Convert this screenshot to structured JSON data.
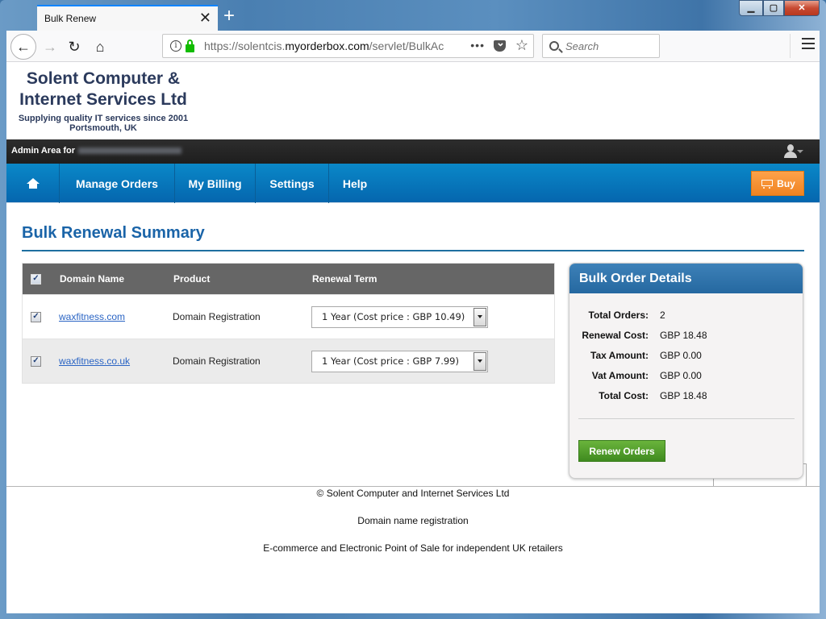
{
  "browser": {
    "tab_title": "Bulk Renew",
    "tab_close_glyph": "✕",
    "new_tab_glyph": "+",
    "url_prefix": "https://solentcis.",
    "url_domain": "myorderbox.com",
    "url_suffix": "/servlet/BulkAc",
    "search_placeholder": "Search",
    "window_controls": {
      "minimize": "▁",
      "maximize": "▢",
      "close": "✕"
    }
  },
  "site": {
    "logo_line1": "Solent Computer &",
    "logo_line2": "Internet Services Ltd",
    "tagline": "Supplying quality IT services since 2001",
    "location": "Portsmouth, UK",
    "admin_label": "Admin Area for"
  },
  "nav": {
    "items": [
      {
        "label": "Manage Orders"
      },
      {
        "label": "My Billing"
      },
      {
        "label": "Settings"
      },
      {
        "label": "Help"
      }
    ],
    "buy_label": "Buy"
  },
  "main": {
    "title": "Bulk Renewal Summary",
    "table": {
      "headers": {
        "domain": "Domain Name",
        "product": "Product",
        "term": "Renewal Term"
      },
      "rows": [
        {
          "checked": true,
          "domain": "waxfitness.com",
          "product": "Domain Registration",
          "term": "1 Year (Cost price : GBP 10.49)"
        },
        {
          "checked": true,
          "domain": "waxfitness.co.uk",
          "product": "Domain Registration",
          "term": "1 Year (Cost price : GBP 7.99)"
        }
      ]
    }
  },
  "order_details": {
    "title": "Bulk Order Details",
    "rows": [
      {
        "label": "Total Orders:",
        "value": "2"
      },
      {
        "label": "Renewal Cost:",
        "value": "GBP 18.48"
      },
      {
        "label": "Tax Amount:",
        "value": "GBP 0.00"
      },
      {
        "label": "Vat Amount:",
        "value": "GBP 0.00"
      },
      {
        "label": "Total Cost:",
        "value": "GBP 18.48"
      }
    ],
    "renew_button": "Renew Orders"
  },
  "footer": {
    "copyright": "© Solent Computer and Internet Services Ltd",
    "line2": "Domain name registration",
    "line3": "E-commerce and Electronic Point of Sale for independent UK retailers"
  },
  "colors": {
    "nav_blue": "#0a7bc0",
    "title_blue": "#1a64a8",
    "buy_orange": "#f68e2c",
    "renew_green": "#4f9b2a",
    "admin_bar": "#262626",
    "table_header": "#666666"
  }
}
